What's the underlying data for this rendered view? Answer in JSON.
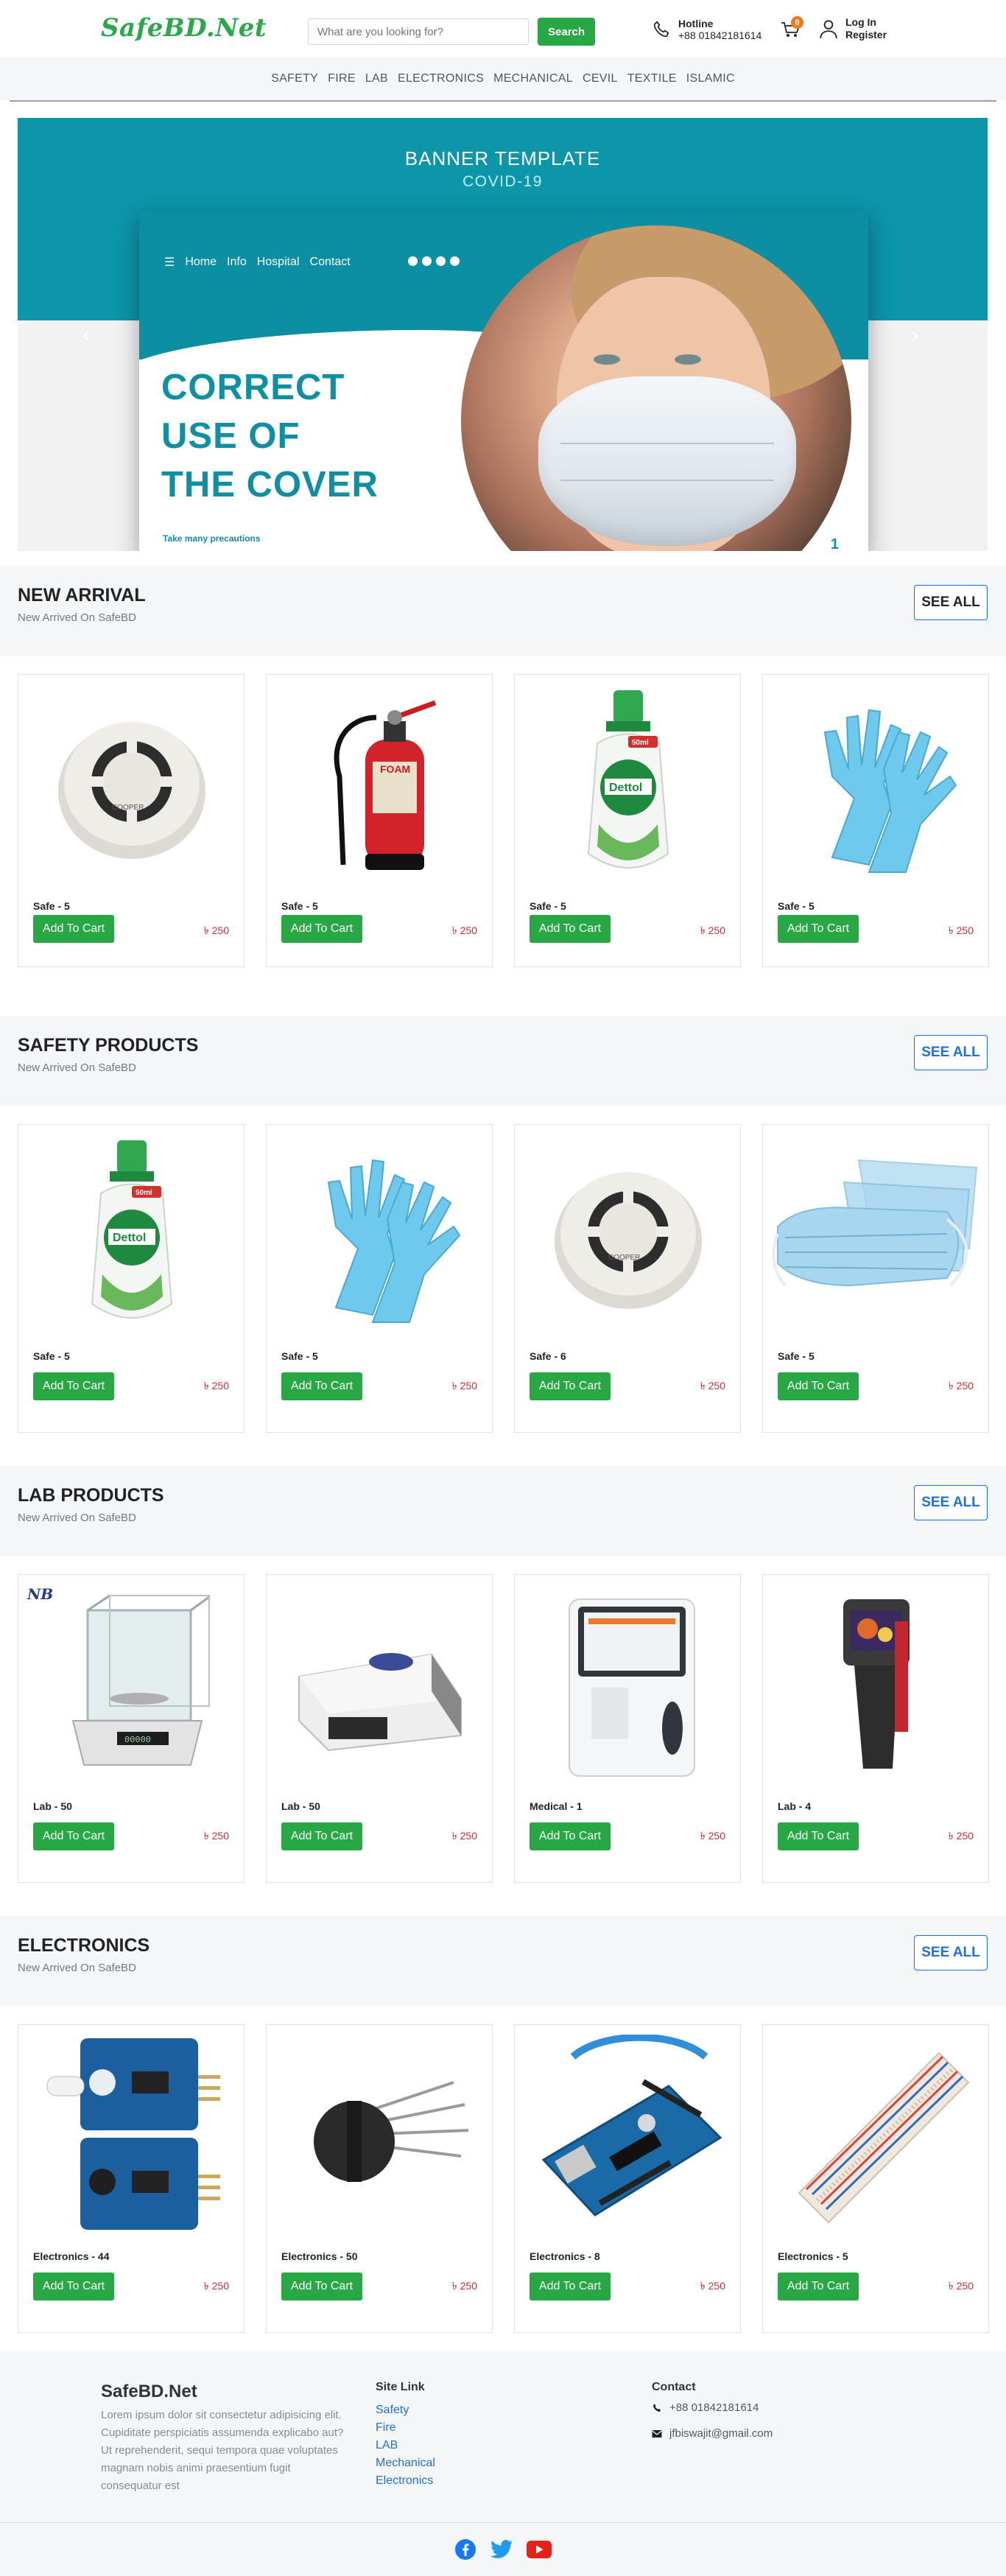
{
  "header": {
    "logo": "SafeBD.Net",
    "search_placeholder": "What are you looking for?",
    "search_label": "Search",
    "hotline_label": "Hotline",
    "hotline_number": "+88 01842181614",
    "cart_count": "0",
    "login_label": "Log In",
    "register_label": "Register"
  },
  "nav": [
    "SAFETY",
    "FIRE",
    "LAB",
    "ELECTRONICS",
    "MECHANICAL",
    "CEVIL",
    "TEXTILE",
    "ISLAMIC"
  ],
  "banner": {
    "title": "BANNER TEMPLATE",
    "subtitle": "COVID-19",
    "menu": [
      "Home",
      "Info",
      "Hospital",
      "Contact"
    ],
    "headline": [
      "CORRECT",
      "USE OF",
      "THE COVER"
    ],
    "tagline": "Take many precautions",
    "page_number": "1"
  },
  "sections": [
    {
      "title": "NEW ARRIVAL",
      "subtitle": "New Arrived On SafeBD",
      "see_all": "SEE ALL",
      "products": [
        {
          "name": "Safe - 5",
          "price": "৳ 250",
          "icon": "smoke-detector-icon"
        },
        {
          "name": "Safe - 5",
          "price": "৳ 250",
          "icon": "fire-extinguisher-icon"
        },
        {
          "name": "Safe - 5",
          "price": "৳ 250",
          "icon": "hand-sanitizer-icon"
        },
        {
          "name": "Safe - 5",
          "price": "৳ 250",
          "icon": "gloves-icon"
        }
      ]
    },
    {
      "title": "SAFETY PRODUCTS",
      "subtitle": "New Arrived On SafeBD",
      "see_all": "SEE ALL",
      "products": [
        {
          "name": "Safe - 5",
          "price": "৳ 250",
          "icon": "hand-sanitizer-icon"
        },
        {
          "name": "Safe - 5",
          "price": "৳ 250",
          "icon": "gloves-icon"
        },
        {
          "name": "Safe - 6",
          "price": "৳ 250",
          "icon": "smoke-detector-icon"
        },
        {
          "name": "Safe - 5",
          "price": "৳ 250",
          "icon": "face-mask-icon"
        }
      ]
    },
    {
      "title": "LAB PRODUCTS",
      "subtitle": "New Arrived On SafeBD",
      "see_all": "SEE ALL",
      "products": [
        {
          "name": "Lab - 50",
          "price": "৳ 250",
          "icon": "lab-balance-icon"
        },
        {
          "name": "Lab - 50",
          "price": "৳ 250",
          "icon": "lab-instrument-icon"
        },
        {
          "name": "Medical - 1",
          "price": "৳ 250",
          "icon": "medical-analyzer-icon"
        },
        {
          "name": "Lab - 4",
          "price": "৳ 250",
          "icon": "thermal-camera-icon"
        }
      ]
    },
    {
      "title": "ELECTRONICS",
      "subtitle": "New Arrived On SafeBD",
      "see_all": "SEE ALL",
      "products": [
        {
          "name": "Electronics - 44",
          "price": "৳ 250",
          "icon": "ir-sensor-module-icon"
        },
        {
          "name": "Electronics - 50",
          "price": "৳ 250",
          "icon": "bridge-rectifier-icon"
        },
        {
          "name": "Electronics - 8",
          "price": "৳ 250",
          "icon": "arduino-board-icon"
        },
        {
          "name": "Electronics - 5",
          "price": "৳ 250",
          "icon": "breadboard-icon"
        }
      ]
    }
  ],
  "add_to_cart": "Add To Cart",
  "nb_logo": "NB",
  "footer": {
    "brand": "SafeBD.Net",
    "about": "Lorem ipsum dolor sit consectetur adipisicing elit. Cupiditate perspiciatis assumenda explicabo aut? Ut reprehenderit, sequi tempora quae voluptates magnam nobis animi praesentium fugit consequatur est",
    "links_title": "Site Link",
    "links": [
      "Safety",
      "Fire",
      "LAB",
      "Mechanical",
      "Electronics"
    ],
    "contact_title": "Contact",
    "phone": "+88 01842181614",
    "email": "jfbiswajit@gmail.com"
  },
  "colors": {
    "brand_green": "#2ba84a",
    "button_green": "#28a745",
    "banner_teal": "#0d95aa",
    "price_red": "#d32f2f",
    "link_blue": "#1e6fe0",
    "badge_orange": "#f07a1c"
  }
}
